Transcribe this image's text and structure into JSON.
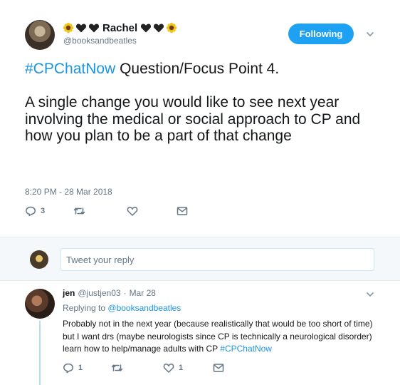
{
  "tweet": {
    "display_name": "Rachel",
    "handle": "@booksandbeatles",
    "follow_label": "Following",
    "hashtag": "#CPChatNow",
    "line1_rest": " Question/Focus Point 4.",
    "body": "A single change you would like to see next year involving the medical or social approach to CP and how you plan to be a part of that change",
    "timestamp": "8:20 PM - 28 Mar 2018",
    "reply_count": "3",
    "retweet_count": "",
    "like_count": ""
  },
  "reply_box": {
    "placeholder": "Tweet your reply"
  },
  "reply": {
    "name": "jen",
    "handle": "@justjen03",
    "separator": "·",
    "date": "Mar 28",
    "replying_to_label": "Replying to",
    "replying_to_handle": "@booksandbeatles",
    "text": "Probably not in the next year (because realistically that would be too short of time) but I want drs (maybe neurologists since CP is technically a neurological disorder) learn how to help/manage adults with CP",
    "hashtag": "#CPChatNow",
    "reply_count": "1",
    "retweet_count": "",
    "like_count": "1"
  },
  "icons": {
    "emoji_left": [
      "sunflower-icon",
      "black-heart-icon",
      "black-heart-icon"
    ],
    "emoji_right": [
      "black-heart-icon",
      "black-heart-icon",
      "sunflower-icon"
    ],
    "actions": [
      "reply-icon",
      "retweet-icon",
      "like-icon",
      "dm-icon"
    ],
    "menu": "chevron-down-icon"
  },
  "colors": {
    "accent": "#1da1f2",
    "link": "#1b95e0",
    "muted": "#657786",
    "text": "#14171a"
  }
}
